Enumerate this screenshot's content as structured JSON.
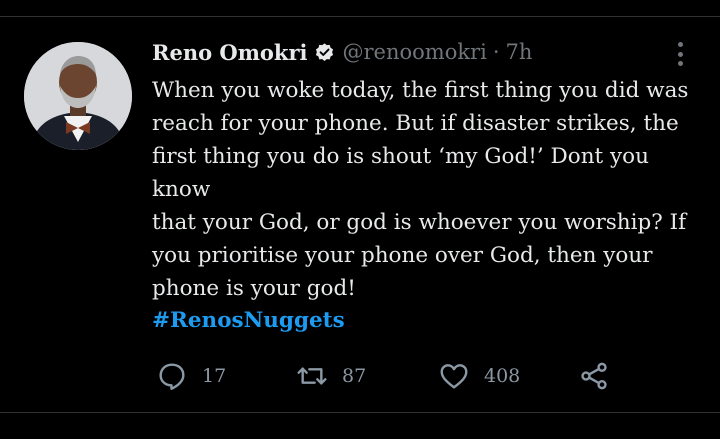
{
  "author": {
    "name": "Reno Omokri",
    "handle": "@renoomokri",
    "separator": "·",
    "time": "7h",
    "verified": true
  },
  "tweet": {
    "text": "When you woke today, the first thing you did was\nreach for your phone. But if disaster strikes, the\nfirst thing you do is shout ‘my God!’ Dont you know\nthat your God, or god is whoever you worship? If\nyou prioritise your phone over God, then your\nphone is your god!",
    "hashtag": "#RenosNuggets"
  },
  "actions": {
    "replies": "17",
    "retweets": "87",
    "likes": "408"
  },
  "icons": [
    "verified-badge-icon",
    "more-options-icon",
    "reply-icon",
    "retweet-icon",
    "like-icon",
    "share-icon"
  ],
  "colors": {
    "background": "#000000",
    "text": "#e7e9ea",
    "muted": "#71767b",
    "link": "#1d9bf0"
  }
}
